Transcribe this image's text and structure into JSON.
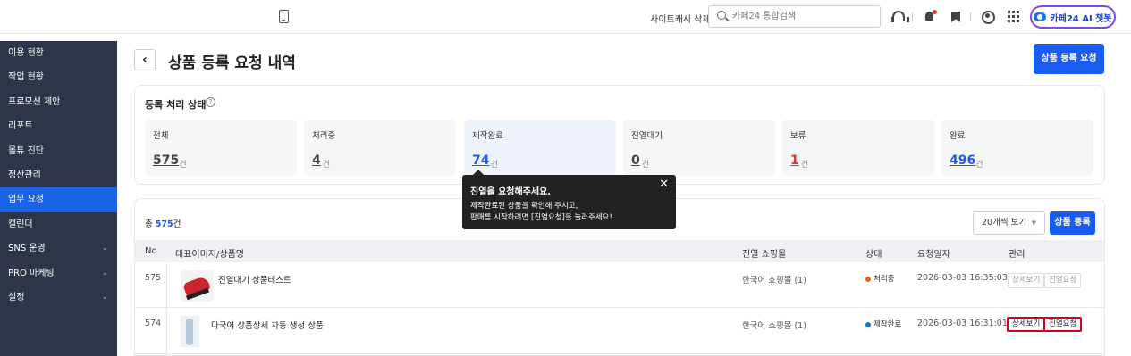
{
  "topbar": {
    "cache_clear": "사이트캐시 삭제",
    "search_placeholder": "카페24 통합검색",
    "ai_chatbot": "카페24 AI 챗봇"
  },
  "sidebar": {
    "items": [
      {
        "label": "이용 현황",
        "active": false,
        "chevron": false
      },
      {
        "label": "작업 현황",
        "active": false,
        "chevron": false
      },
      {
        "label": "프로모션 제안",
        "active": false,
        "chevron": false
      },
      {
        "label": "리포트",
        "active": false,
        "chevron": false
      },
      {
        "label": "몰튜 진단",
        "active": false,
        "chevron": false
      },
      {
        "label": "정산관리",
        "active": false,
        "chevron": false
      },
      {
        "label": "업무 요청",
        "active": true,
        "chevron": false
      },
      {
        "label": "캘린더",
        "active": false,
        "chevron": false
      },
      {
        "label": "SNS 운영",
        "active": false,
        "chevron": true
      },
      {
        "label": "PRO 마케팅",
        "active": false,
        "chevron": true
      },
      {
        "label": "설정",
        "active": false,
        "chevron": true
      }
    ]
  },
  "header": {
    "back_icon": "‹",
    "title": "상품 등록 요청 내역",
    "register_request_button": "상품 등록 요청"
  },
  "status_card": {
    "heading": "등록 처리 상태",
    "help_icon": "?",
    "unit": "건",
    "stats": [
      {
        "label": "전체",
        "value": "575",
        "color": "#444444"
      },
      {
        "label": "처리중",
        "value": "4",
        "color": "#444444"
      },
      {
        "label": "제작완료",
        "value": "74",
        "color": "#1a5cf2"
      },
      {
        "label": "진열대기",
        "value": "0",
        "color": "#444444"
      },
      {
        "label": "보류",
        "value": "1",
        "color": "#e5322c"
      },
      {
        "label": "완료",
        "value": "496",
        "color": "#1a5cf2"
      }
    ]
  },
  "tooltip": {
    "title": "진열을 요청해주세요.",
    "line1": "제작완료된 상품을 확인해 주시고,",
    "line2": "판매를 시작하려면 [진열요청]을 눌러주세요!",
    "close": "✕"
  },
  "list": {
    "total_prefix": "총 ",
    "total_count": "575",
    "total_suffix": "건",
    "page_size": "20개씩 보기",
    "add_button": "상품 등록",
    "columns": [
      "No",
      "대표이미지/상품명",
      "진열 쇼핑몰",
      "상태",
      "요청일자",
      "관리"
    ],
    "rows": [
      {
        "no": "575",
        "name": "진열대기 상품테스트",
        "mall": "한국어 쇼핑몰 (1)",
        "status": "처리중",
        "status_color": "#e8630a",
        "date": "2026-03-03 16:35:03",
        "btn_detail": "상세보기",
        "btn_display": "진열요청",
        "highlighted": false
      },
      {
        "no": "574",
        "name": "다국어 상품상세 자동 생성 상품",
        "mall": "한국어 쇼핑몰 (1)",
        "status": "제작완료",
        "status_color": "#1a72e8",
        "date": "2026-03-03 16:31:01",
        "btn_detail": "상세보기",
        "btn_display": "진열요청",
        "highlighted": true
      }
    ]
  }
}
